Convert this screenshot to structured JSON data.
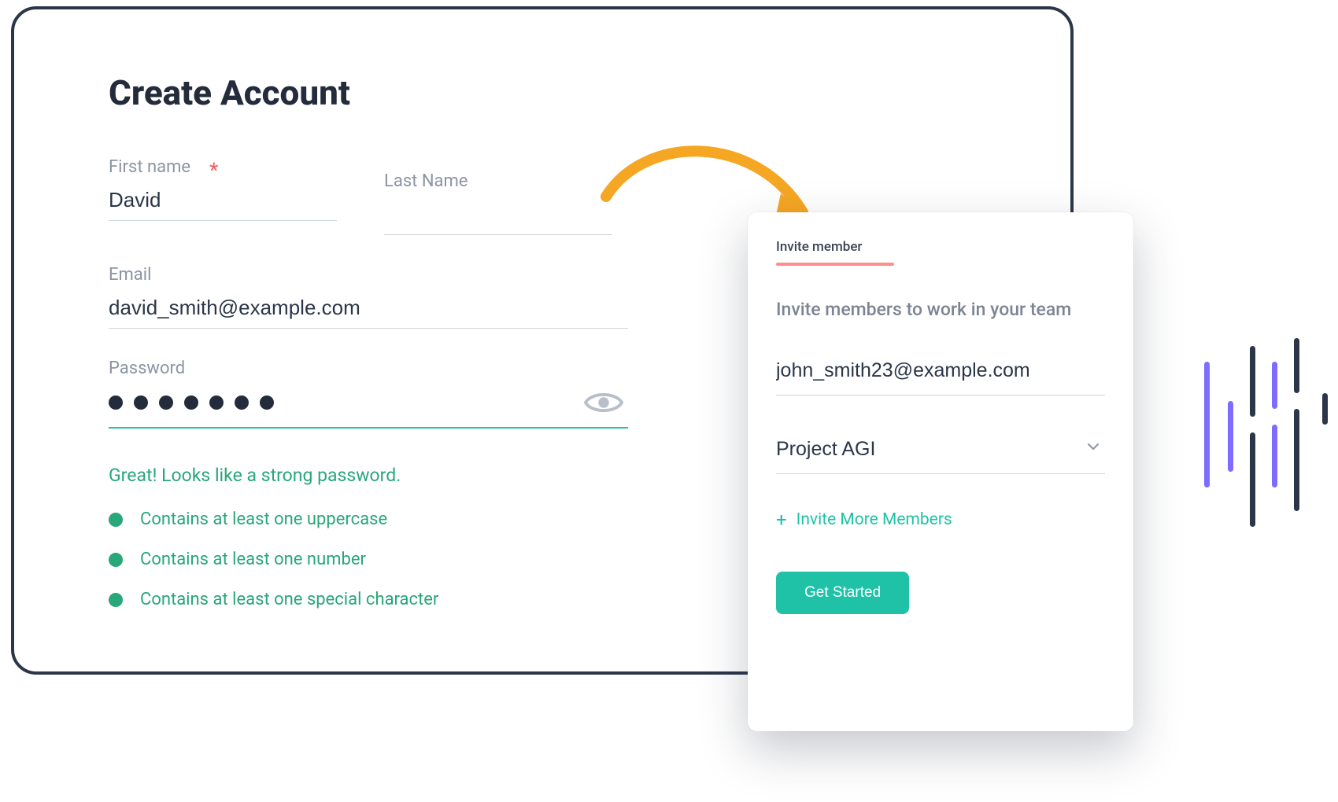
{
  "create_account": {
    "title": "Create Account",
    "first_name": {
      "label": "First name",
      "value": "David",
      "required": true
    },
    "last_name": {
      "label": "Last Name",
      "value": ""
    },
    "email": {
      "label": "Email",
      "value": "david_smith@example.com"
    },
    "password": {
      "label": "Password",
      "value": "•••••••",
      "masked_length": 7
    },
    "strength_message": "Great! Looks like a strong password.",
    "rules": [
      "Contains at least one uppercase",
      "Contains at least one number",
      "Contains at least one special character"
    ]
  },
  "invite": {
    "tab_label": "Invite member",
    "heading": "Invite members to work in your team",
    "email_value": "john_smith23@example.com",
    "project_value": "Project AGI",
    "invite_more_label": "Invite More Members",
    "cta_label": "Get Started"
  },
  "colors": {
    "teal": "#1fc2a7",
    "green": "#28a779",
    "orange": "#f5a623",
    "purple": "#7d6cff",
    "dark": "#2b3648",
    "red": "#ff5a5a",
    "pink_underline": "#ff8d8d"
  }
}
